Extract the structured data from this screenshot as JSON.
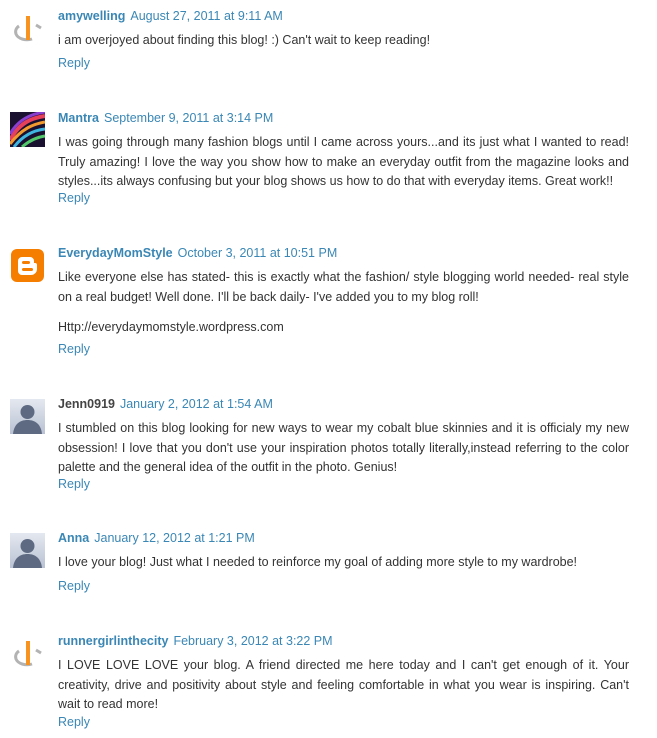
{
  "comments": [
    {
      "author": "amywelling",
      "timestamp": "August 27, 2011 at 9:11 AM",
      "avatar_icon": "openid-icon",
      "paragraphs": [
        "i am overjoyed about finding this blog! :) Can't wait to keep reading!"
      ],
      "reply_label": "Reply"
    },
    {
      "author": "Mantra",
      "timestamp": "September 9, 2011 at 3:14 PM",
      "avatar_icon": "swirl-photo-icon",
      "paragraphs": [
        "I was going through many fashion blogs until I came across yours...and its just what I wanted to read! Truly amazing! I love the way you show how to make an everyday outfit from the magazine looks and styles...its always confusing but your blog shows us how to do that with everyday items. Great work!!"
      ],
      "reply_label": "Reply"
    },
    {
      "author": "EverydayMomStyle",
      "timestamp": "October 3, 2011 at 10:51 PM",
      "avatar_icon": "blogger-icon",
      "paragraphs": [
        "Like everyone else has stated- this is exactly what the fashion/ style blogging world needed- real style on a real budget! Well done. I'll be back daily- I've added you to my blog roll!",
        "Http://everydaymomstyle.wordpress.com"
      ],
      "reply_label": "Reply"
    },
    {
      "author": "Jenn0919",
      "timestamp": "January 2, 2012 at 1:54 AM",
      "avatar_icon": "default-user-icon",
      "paragraphs": [
        "I stumbled on this blog looking for new ways to wear my cobalt blue skinnies and it is officialy my new obsession! I love that you don't use your inspiration photos totally literally,instead referring to the color palette and the general idea of the outfit in the photo. Genius!"
      ],
      "reply_label": "Reply"
    },
    {
      "author": "Anna",
      "timestamp": "January 12, 2012 at 1:21 PM",
      "avatar_icon": "default-user-icon",
      "paragraphs": [
        "I love your blog! Just what I needed to reinforce my goal of adding more style to my wardrobe!"
      ],
      "reply_label": "Reply"
    },
    {
      "author": "runnergirlinthecity",
      "timestamp": "February 3, 2012 at 3:22 PM",
      "avatar_icon": "openid-icon",
      "paragraphs": [
        "I LOVE LOVE LOVE your blog. A friend directed me here today and I can't get enough of it. Your creativity, drive and positivity about style and feeling comfortable in what you wear is inspiring. Can't wait to read more!"
      ],
      "reply_label": "Reply"
    }
  ]
}
